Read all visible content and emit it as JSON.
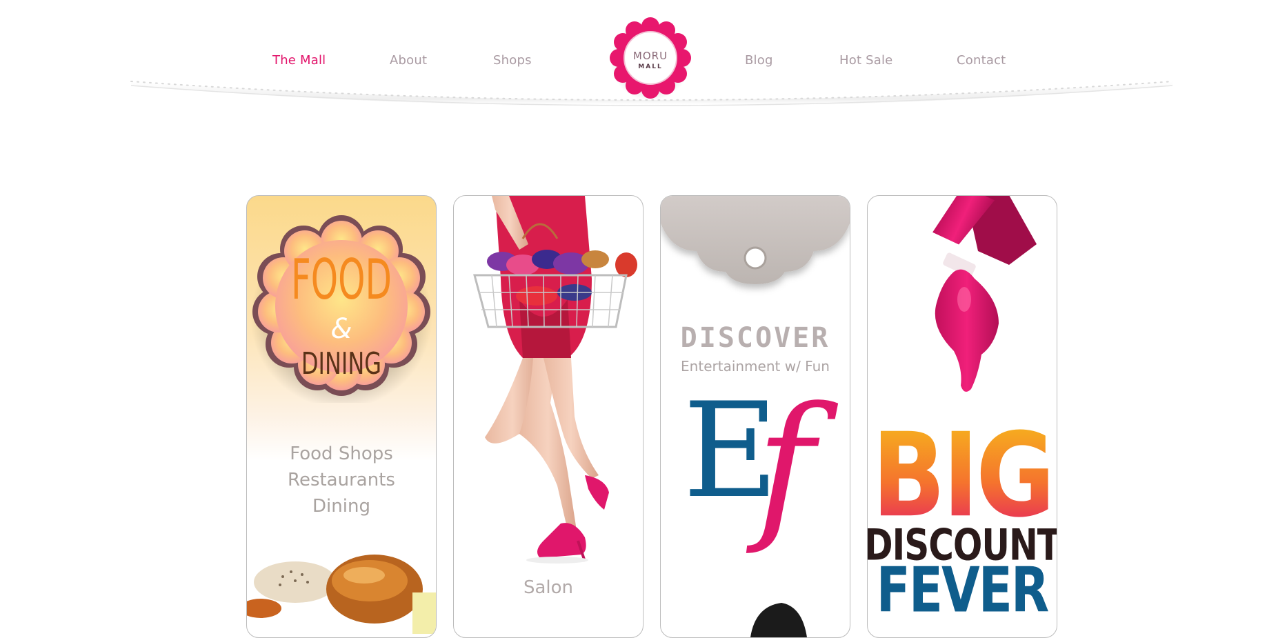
{
  "nav": {
    "left": [
      {
        "label": "The Mall",
        "active": true
      },
      {
        "label": "About",
        "active": false
      },
      {
        "label": "Shops",
        "active": false
      }
    ],
    "right": [
      {
        "label": "Blog",
        "active": false
      },
      {
        "label": "Hot Sale",
        "active": false
      },
      {
        "label": "Contact",
        "active": false
      }
    ]
  },
  "logo": {
    "line1": "MORU",
    "line2": "MALL",
    "icon": "flower-badge-icon"
  },
  "cards": {
    "food": {
      "title_top": "FOOD",
      "amp": "&",
      "title_bottom": "DINING",
      "links": [
        "Food Shops",
        "Restaurants",
        "Dining"
      ],
      "image": "bread-photo"
    },
    "fashion": {
      "image": "woman-with-shoe-basket-photo",
      "label": "Salon"
    },
    "entertainment": {
      "title": "DISCOVER",
      "subtitle": "Entertainment w/ Fun",
      "monogram_e": "E",
      "monogram_f": "f",
      "image": "person-head-photo"
    },
    "sale": {
      "image": "nail-polish-bottle-photo",
      "word1": "BIG",
      "word2": "DISCOUNT",
      "word3": "FEVER"
    }
  },
  "colors": {
    "accent": "#e2136a",
    "nav_text": "#a99aa2",
    "card_border": "#bcbcbc"
  }
}
